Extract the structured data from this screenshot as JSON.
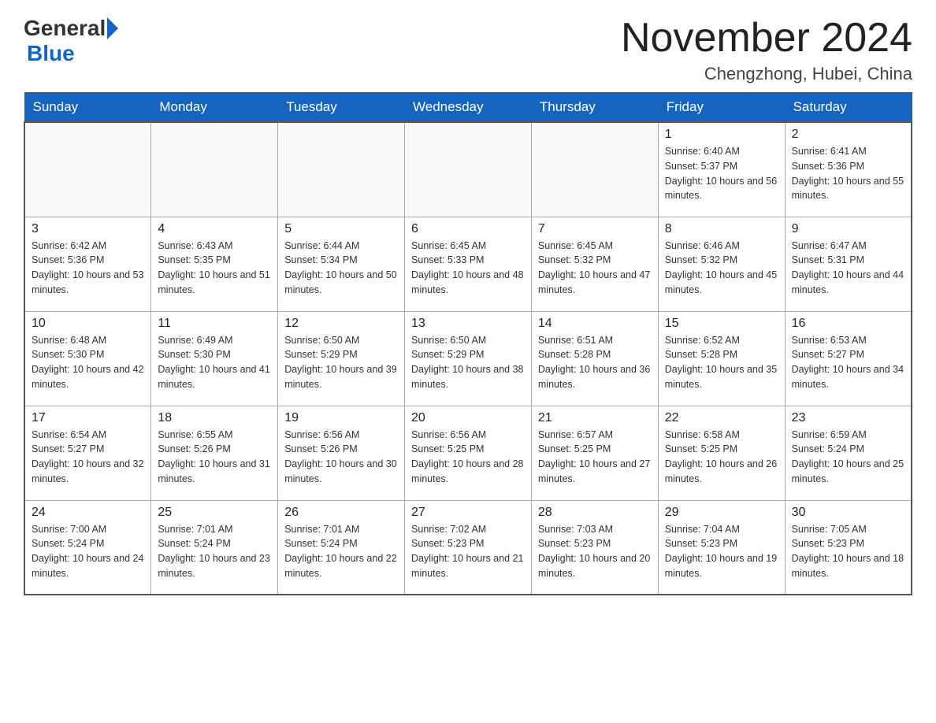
{
  "logo": {
    "general": "General",
    "blue": "Blue"
  },
  "title": "November 2024",
  "subtitle": "Chengzhong, Hubei, China",
  "weekdays": [
    "Sunday",
    "Monday",
    "Tuesday",
    "Wednesday",
    "Thursday",
    "Friday",
    "Saturday"
  ],
  "weeks": [
    [
      {
        "day": "",
        "info": ""
      },
      {
        "day": "",
        "info": ""
      },
      {
        "day": "",
        "info": ""
      },
      {
        "day": "",
        "info": ""
      },
      {
        "day": "",
        "info": ""
      },
      {
        "day": "1",
        "info": "Sunrise: 6:40 AM\nSunset: 5:37 PM\nDaylight: 10 hours and 56 minutes."
      },
      {
        "day": "2",
        "info": "Sunrise: 6:41 AM\nSunset: 5:36 PM\nDaylight: 10 hours and 55 minutes."
      }
    ],
    [
      {
        "day": "3",
        "info": "Sunrise: 6:42 AM\nSunset: 5:36 PM\nDaylight: 10 hours and 53 minutes."
      },
      {
        "day": "4",
        "info": "Sunrise: 6:43 AM\nSunset: 5:35 PM\nDaylight: 10 hours and 51 minutes."
      },
      {
        "day": "5",
        "info": "Sunrise: 6:44 AM\nSunset: 5:34 PM\nDaylight: 10 hours and 50 minutes."
      },
      {
        "day": "6",
        "info": "Sunrise: 6:45 AM\nSunset: 5:33 PM\nDaylight: 10 hours and 48 minutes."
      },
      {
        "day": "7",
        "info": "Sunrise: 6:45 AM\nSunset: 5:32 PM\nDaylight: 10 hours and 47 minutes."
      },
      {
        "day": "8",
        "info": "Sunrise: 6:46 AM\nSunset: 5:32 PM\nDaylight: 10 hours and 45 minutes."
      },
      {
        "day": "9",
        "info": "Sunrise: 6:47 AM\nSunset: 5:31 PM\nDaylight: 10 hours and 44 minutes."
      }
    ],
    [
      {
        "day": "10",
        "info": "Sunrise: 6:48 AM\nSunset: 5:30 PM\nDaylight: 10 hours and 42 minutes."
      },
      {
        "day": "11",
        "info": "Sunrise: 6:49 AM\nSunset: 5:30 PM\nDaylight: 10 hours and 41 minutes."
      },
      {
        "day": "12",
        "info": "Sunrise: 6:50 AM\nSunset: 5:29 PM\nDaylight: 10 hours and 39 minutes."
      },
      {
        "day": "13",
        "info": "Sunrise: 6:50 AM\nSunset: 5:29 PM\nDaylight: 10 hours and 38 minutes."
      },
      {
        "day": "14",
        "info": "Sunrise: 6:51 AM\nSunset: 5:28 PM\nDaylight: 10 hours and 36 minutes."
      },
      {
        "day": "15",
        "info": "Sunrise: 6:52 AM\nSunset: 5:28 PM\nDaylight: 10 hours and 35 minutes."
      },
      {
        "day": "16",
        "info": "Sunrise: 6:53 AM\nSunset: 5:27 PM\nDaylight: 10 hours and 34 minutes."
      }
    ],
    [
      {
        "day": "17",
        "info": "Sunrise: 6:54 AM\nSunset: 5:27 PM\nDaylight: 10 hours and 32 minutes."
      },
      {
        "day": "18",
        "info": "Sunrise: 6:55 AM\nSunset: 5:26 PM\nDaylight: 10 hours and 31 minutes."
      },
      {
        "day": "19",
        "info": "Sunrise: 6:56 AM\nSunset: 5:26 PM\nDaylight: 10 hours and 30 minutes."
      },
      {
        "day": "20",
        "info": "Sunrise: 6:56 AM\nSunset: 5:25 PM\nDaylight: 10 hours and 28 minutes."
      },
      {
        "day": "21",
        "info": "Sunrise: 6:57 AM\nSunset: 5:25 PM\nDaylight: 10 hours and 27 minutes."
      },
      {
        "day": "22",
        "info": "Sunrise: 6:58 AM\nSunset: 5:25 PM\nDaylight: 10 hours and 26 minutes."
      },
      {
        "day": "23",
        "info": "Sunrise: 6:59 AM\nSunset: 5:24 PM\nDaylight: 10 hours and 25 minutes."
      }
    ],
    [
      {
        "day": "24",
        "info": "Sunrise: 7:00 AM\nSunset: 5:24 PM\nDaylight: 10 hours and 24 minutes."
      },
      {
        "day": "25",
        "info": "Sunrise: 7:01 AM\nSunset: 5:24 PM\nDaylight: 10 hours and 23 minutes."
      },
      {
        "day": "26",
        "info": "Sunrise: 7:01 AM\nSunset: 5:24 PM\nDaylight: 10 hours and 22 minutes."
      },
      {
        "day": "27",
        "info": "Sunrise: 7:02 AM\nSunset: 5:23 PM\nDaylight: 10 hours and 21 minutes."
      },
      {
        "day": "28",
        "info": "Sunrise: 7:03 AM\nSunset: 5:23 PM\nDaylight: 10 hours and 20 minutes."
      },
      {
        "day": "29",
        "info": "Sunrise: 7:04 AM\nSunset: 5:23 PM\nDaylight: 10 hours and 19 minutes."
      },
      {
        "day": "30",
        "info": "Sunrise: 7:05 AM\nSunset: 5:23 PM\nDaylight: 10 hours and 18 minutes."
      }
    ]
  ]
}
